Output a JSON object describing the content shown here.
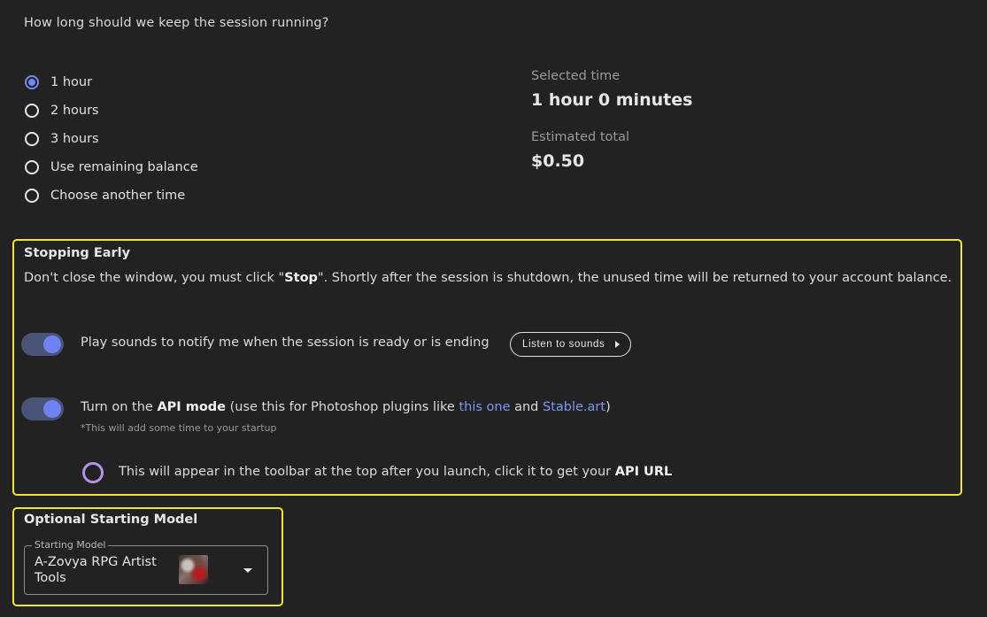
{
  "question": "How long should we keep the session running?",
  "duration_options": [
    {
      "label": "1 hour",
      "selected": true
    },
    {
      "label": "2 hours",
      "selected": false
    },
    {
      "label": "3 hours",
      "selected": false
    },
    {
      "label": "Use remaining balance",
      "selected": false
    },
    {
      "label": "Choose another time",
      "selected": false
    }
  ],
  "summary": {
    "selected_time_label": "Selected time",
    "selected_time_value": "1 hour 0 minutes",
    "estimated_total_label": "Estimated total",
    "estimated_total_value": "$0.50"
  },
  "stopping_early": {
    "title": "Stopping Early",
    "desc_prefix": "Don't close the window, you must click \"",
    "desc_bold": "Stop",
    "desc_suffix": "\". Shortly after the session is shutdown, the unused time will be returned to your account balance."
  },
  "sounds_option": {
    "enabled": true,
    "text": "Play sounds to notify me when the session is ready or is ending",
    "button_label": "Listen to sounds"
  },
  "api_option": {
    "enabled": true,
    "prefix": "Turn on the ",
    "bold": "API mode",
    "middle": " (use this for Photoshop plugins like ",
    "link1": "this one",
    "and": " and ",
    "link2": "Stable.art",
    "suffix": ")",
    "note": "*This will add some time to your startup"
  },
  "api_hint": {
    "text": "This will appear in the toolbar at the top after you launch, click it to get your ",
    "bold": "API URL"
  },
  "starting_model": {
    "title": "Optional Starting Model",
    "field_label": "Starting Model",
    "value": "A-Zovya RPG Artist Tools"
  },
  "colors": {
    "background": "#222222",
    "accent": "#6e82f0",
    "highlight_border": "#f0e33a",
    "link": "#7f96f3"
  }
}
